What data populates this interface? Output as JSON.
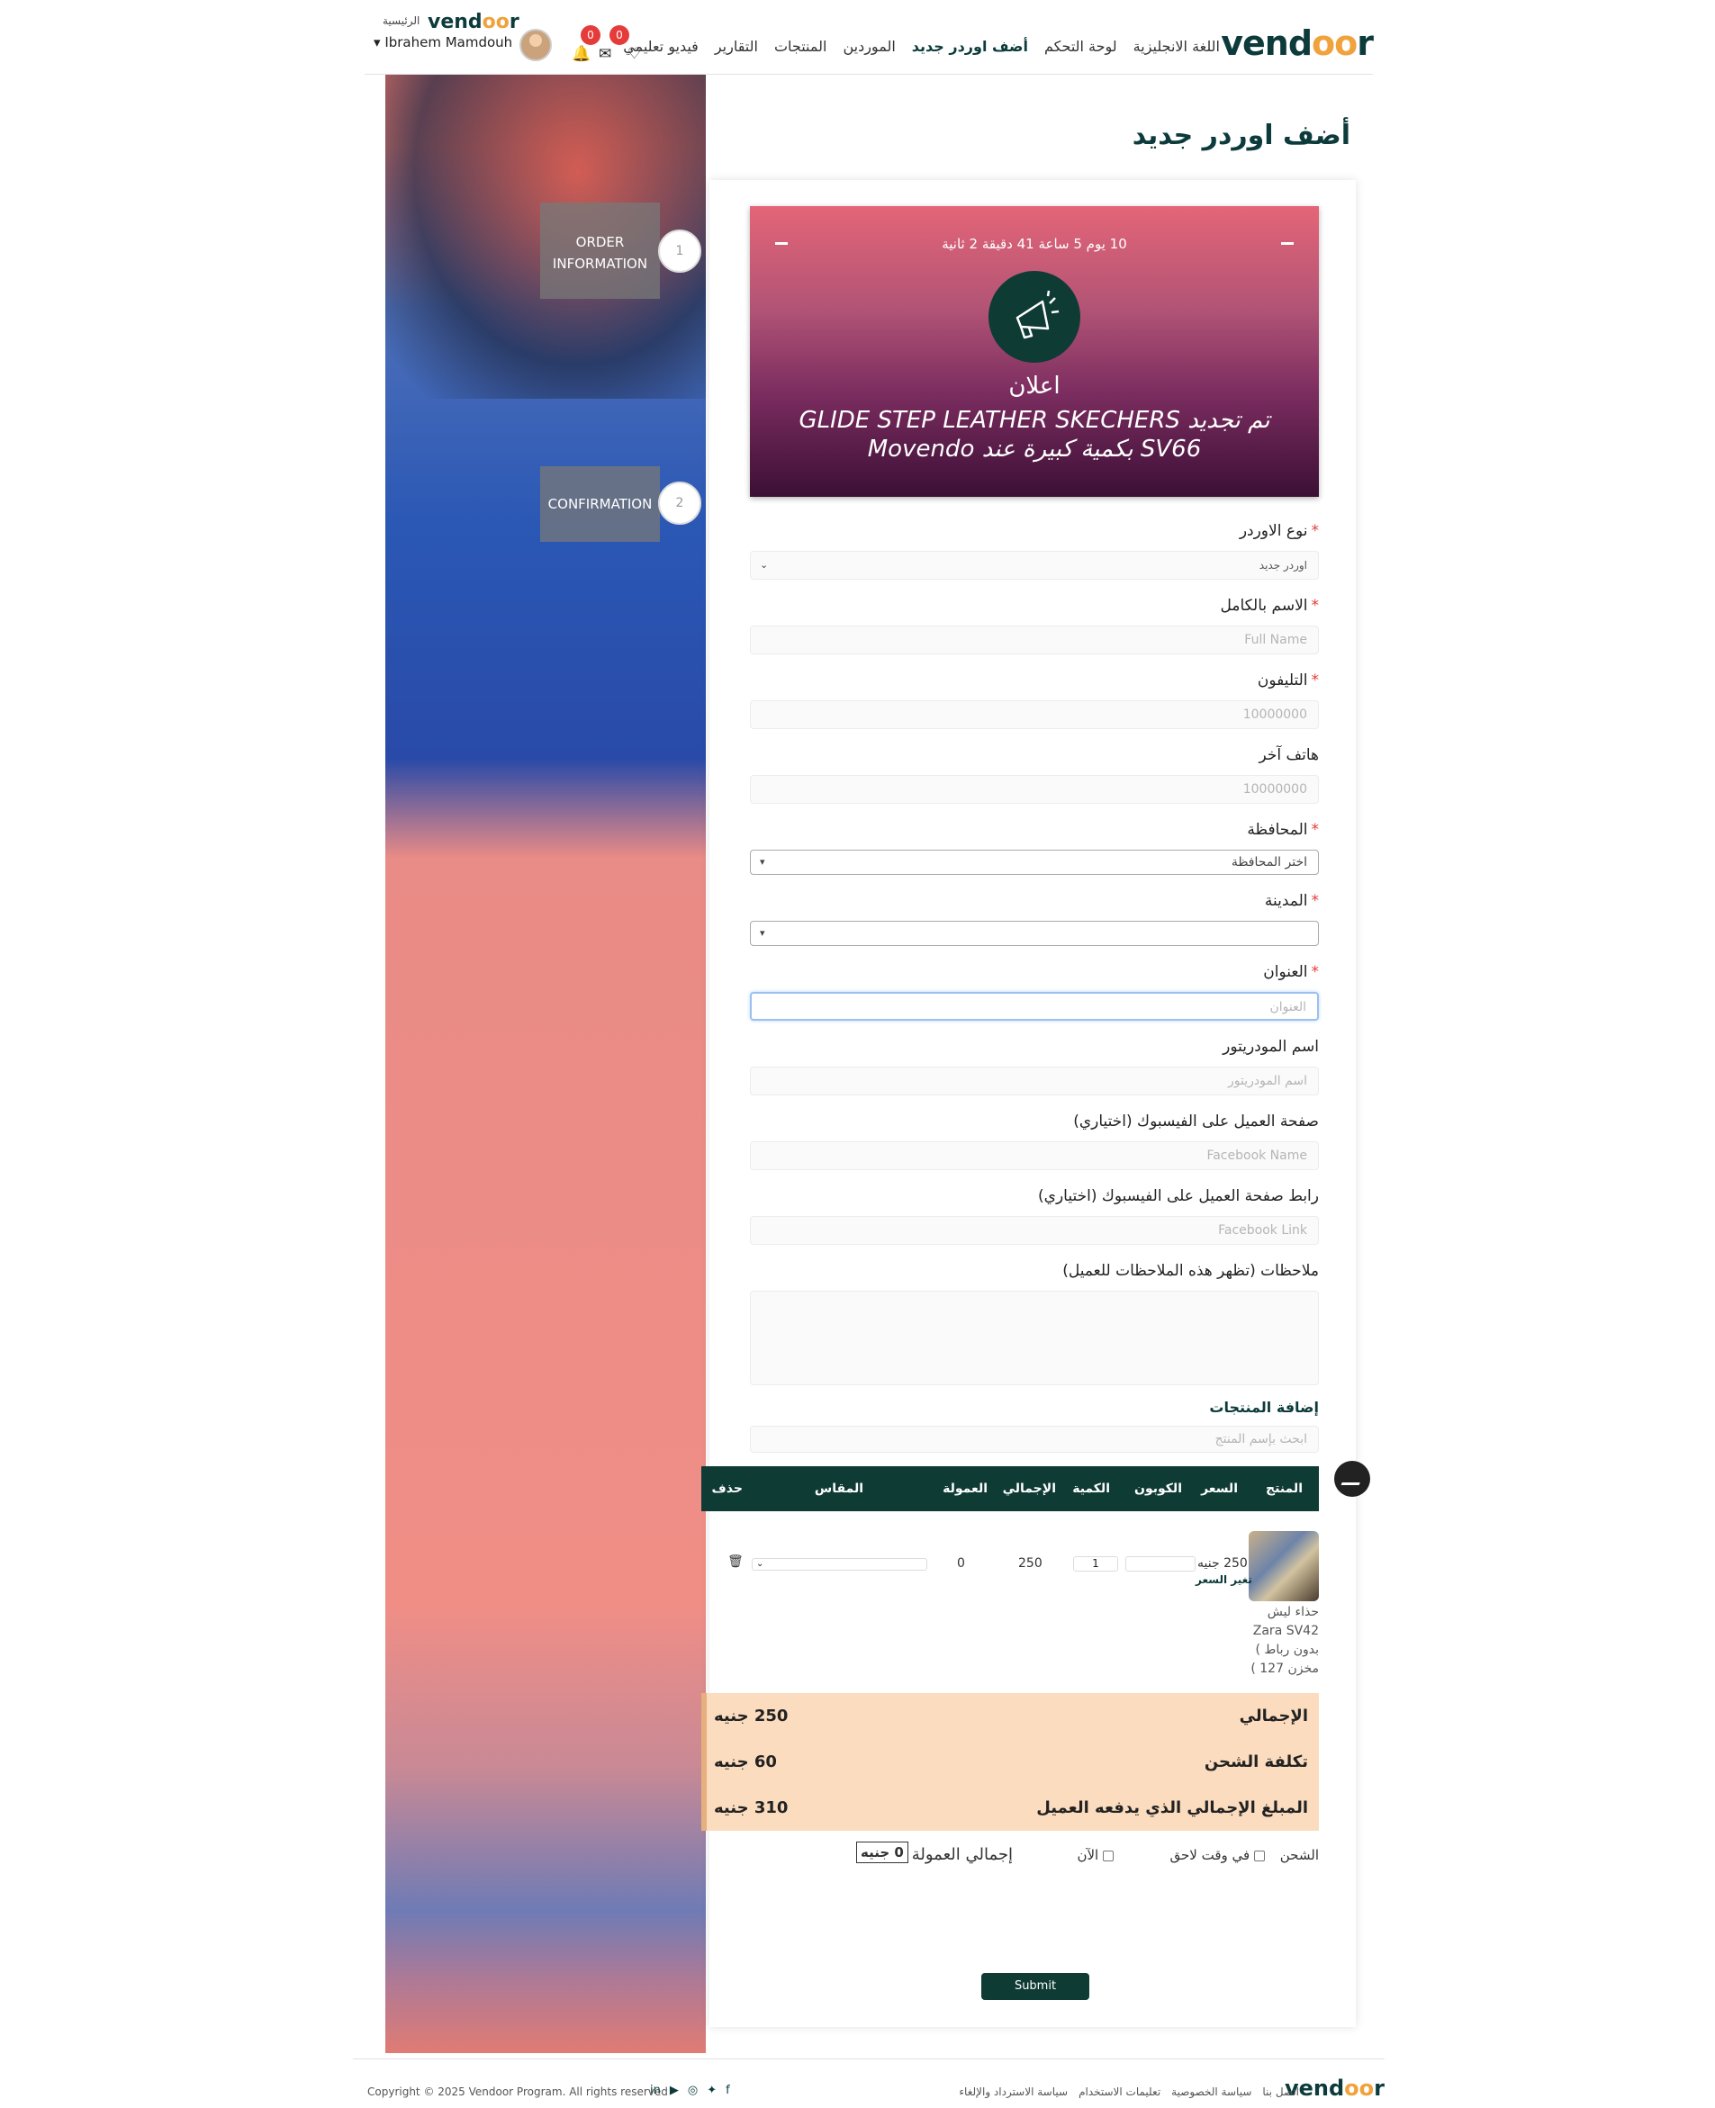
{
  "header": {
    "logo_main": "vendoor",
    "small_logo": "vendoor",
    "home_label": "الرئيسية",
    "username": "Ibrahem Mamdouh",
    "nav": [
      "اللغة الانجليزية",
      "لوحة التحكم",
      "أضف اوردر جديد",
      "الموردين",
      "المنتجات",
      "التقارير",
      "فيديو تعليمي"
    ],
    "active_nav_index": 2,
    "mail_count": "0",
    "notif_count": "0"
  },
  "steps": [
    {
      "num": "1",
      "label": "ORDER INFORMATION"
    },
    {
      "num": "2",
      "label": "CONFIRMATION"
    }
  ],
  "page_title": "أضف اوردر جديد",
  "promo": {
    "timer": "10 يوم 5 ساعة 41 دقيقة 2 ثانية",
    "title": "اعلان",
    "message": "تم تجديد GLIDE STEP LEATHER SKECHERS SV66 بكمية كبيرة عند Movendo"
  },
  "form": {
    "order_type": {
      "label": "نوع الاوردر",
      "value": "اوردر جديد"
    },
    "full_name": {
      "label": "الاسم بالكامل",
      "placeholder": "Full Name"
    },
    "phone": {
      "label": "التليفون",
      "placeholder": "10000000"
    },
    "other_phone": {
      "label": "هاتف آخر",
      "placeholder": "10000000"
    },
    "governorate": {
      "label": "المحافظة",
      "value": "اختر المحافظة"
    },
    "city": {
      "label": "المدينة",
      "value": ""
    },
    "address": {
      "label": "العنوان",
      "placeholder": "العنوان"
    },
    "moderator": {
      "label": "اسم المودريتور",
      "placeholder": "اسم المودريتور"
    },
    "fb_page": {
      "label": "صفحة العميل على الفيسبوك (اختياري)",
      "placeholder": "Facebook Name"
    },
    "fb_link": {
      "label": "رابط صفحة العميل على الفيسبوك (اختياري)",
      "placeholder": "Facebook Link"
    },
    "notes": {
      "label": "ملاحظات (تظهر هذه الملاحظات للعميل)"
    }
  },
  "products": {
    "section_title": "إضافة المنتجات",
    "search_placeholder": "ابحث بإسم المنتج",
    "columns": [
      "المنتج",
      "السعر",
      "الكوبون",
      "الكمية",
      "الإجمالي",
      "العمولة",
      "المقاس",
      "حذف"
    ],
    "rows": [
      {
        "price": "250 جنيه",
        "change_price": "تغير السعر",
        "quantity": "1",
        "total": "250",
        "commission": "0",
        "name_lines": [
          "حذاء ليش",
          "Zara SV42",
          "بدون رباط )",
          "مخزن 127 )"
        ]
      }
    ]
  },
  "totals": {
    "subtotal_label": "الإجمالي",
    "subtotal_value": "250 جنيه",
    "shipping_label": "تكلفة الشحن",
    "shipping_value": "60 جنيه",
    "grand_label": "المبلغ الإجمالي الذي يدفعه العميل",
    "grand_value": "310 جنيه"
  },
  "shipping": {
    "label": "الشحن",
    "later": "في وقت لاحق",
    "now": "الآن",
    "commission_label": "إجمالي العمولة",
    "commission_value": "0 جنيه"
  },
  "submit_label": "Submit",
  "footer": {
    "logo": "vendoor",
    "links": [
      "اتصل بنا",
      "سياسة الخصوصية",
      "تعليمات الاستخدام",
      "سياسة الاسترداد والإلغاء"
    ],
    "copyright": "Copyright © 2025 Vendoor Program. All rights reserved"
  },
  "colors": {
    "brand": "#0f3b35",
    "accent": "#f0a23c",
    "required": "#e53b3b",
    "totals_bg": "#fcdcbf"
  }
}
